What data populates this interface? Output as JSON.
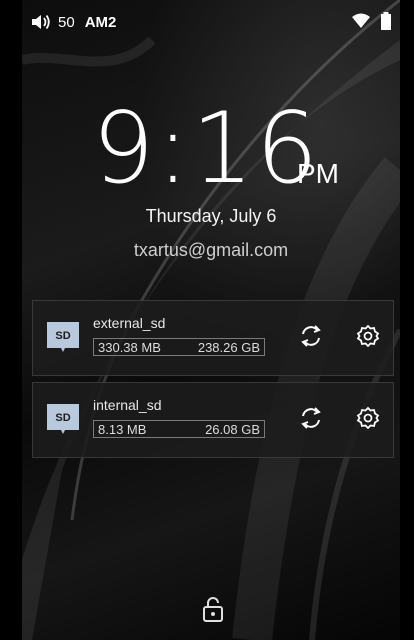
{
  "status_bar": {
    "volume_icon": "speaker-icon",
    "volume_level": "50",
    "network_label": "AM2",
    "wifi_icon": "wifi-icon",
    "battery_icon": "battery-icon"
  },
  "lockscreen": {
    "time": "9:16",
    "ampm": "PM",
    "date": "Thursday, July 6",
    "account": "txartus@gmail.com",
    "unlock_icon": "unlock-icon"
  },
  "storage": [
    {
      "name": "external_sd",
      "used": "330.38 MB",
      "total": "238.26 GB",
      "icon": "sd-card-icon",
      "sync_icon": "sync-icon",
      "settings_icon": "gear-icon"
    },
    {
      "name": "internal_sd",
      "used": "8.13 MB",
      "total": "26.08 GB",
      "icon": "sd-card-icon",
      "sync_icon": "sync-icon",
      "settings_icon": "gear-icon"
    }
  ],
  "colors": {
    "background": "#000000",
    "card_bg": "#1c1c1c",
    "sd_icon": "#b9c9dd",
    "text": "#ffffff"
  }
}
